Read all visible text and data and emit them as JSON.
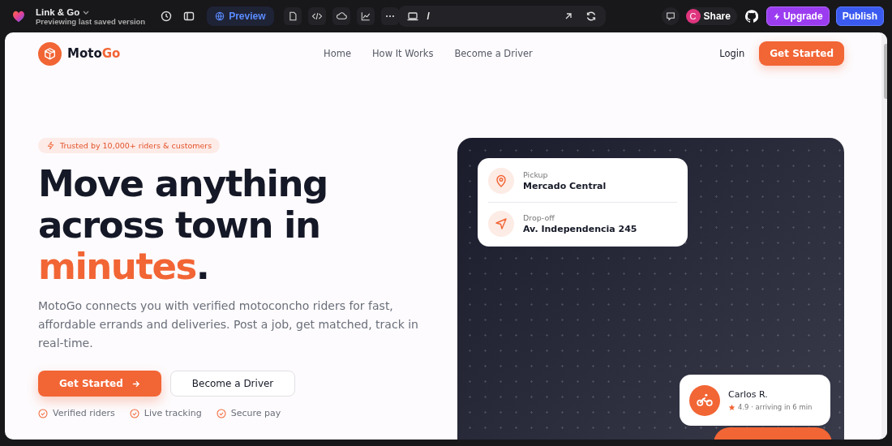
{
  "app_bar": {
    "project_name": "Link & Go",
    "subtitle": "Previewing last saved version",
    "preview_label": "Preview",
    "url_path": "/",
    "avatar_initial": "C",
    "share_label": "Share",
    "upgrade_label": "Upgrade",
    "publish_label": "Publish"
  },
  "site": {
    "nav": {
      "brand": [
        {
          "text": "Moto",
          "accent": false
        },
        {
          "text": "Go",
          "accent": true
        }
      ],
      "links": [
        "Home",
        "How It Works",
        "Become a Driver"
      ],
      "login": "Login",
      "cta": "Get Started"
    },
    "hero": {
      "badge": "Trusted by 10,000+ riders & customers",
      "headline": [
        [
          {
            "text": "Move anything",
            "accent": false
          }
        ],
        [
          {
            "text": "across town in",
            "accent": false
          }
        ],
        [
          {
            "text": "minutes",
            "accent": true
          },
          {
            "text": ".",
            "accent": false
          }
        ]
      ],
      "paragraph": "MotoGo connects you with verified motoconcho riders for fast, affordable errands and deliveries. Post a job, get matched, track in real-time.",
      "primary_button": "Get Started",
      "secondary_button": "Become a Driver",
      "features": [
        "Verified riders",
        "Live tracking",
        "Secure pay"
      ]
    },
    "route_card": {
      "stops": [
        {
          "kind": "pickup",
          "label": "Pickup",
          "value": "Mercado Central"
        },
        {
          "kind": "dropoff",
          "label": "Drop-off",
          "value": "Av. Independencia 245"
        }
      ]
    },
    "rider_card": {
      "name": "Carlos R.",
      "detail": "4.9 · arriving in 6 min"
    }
  }
}
